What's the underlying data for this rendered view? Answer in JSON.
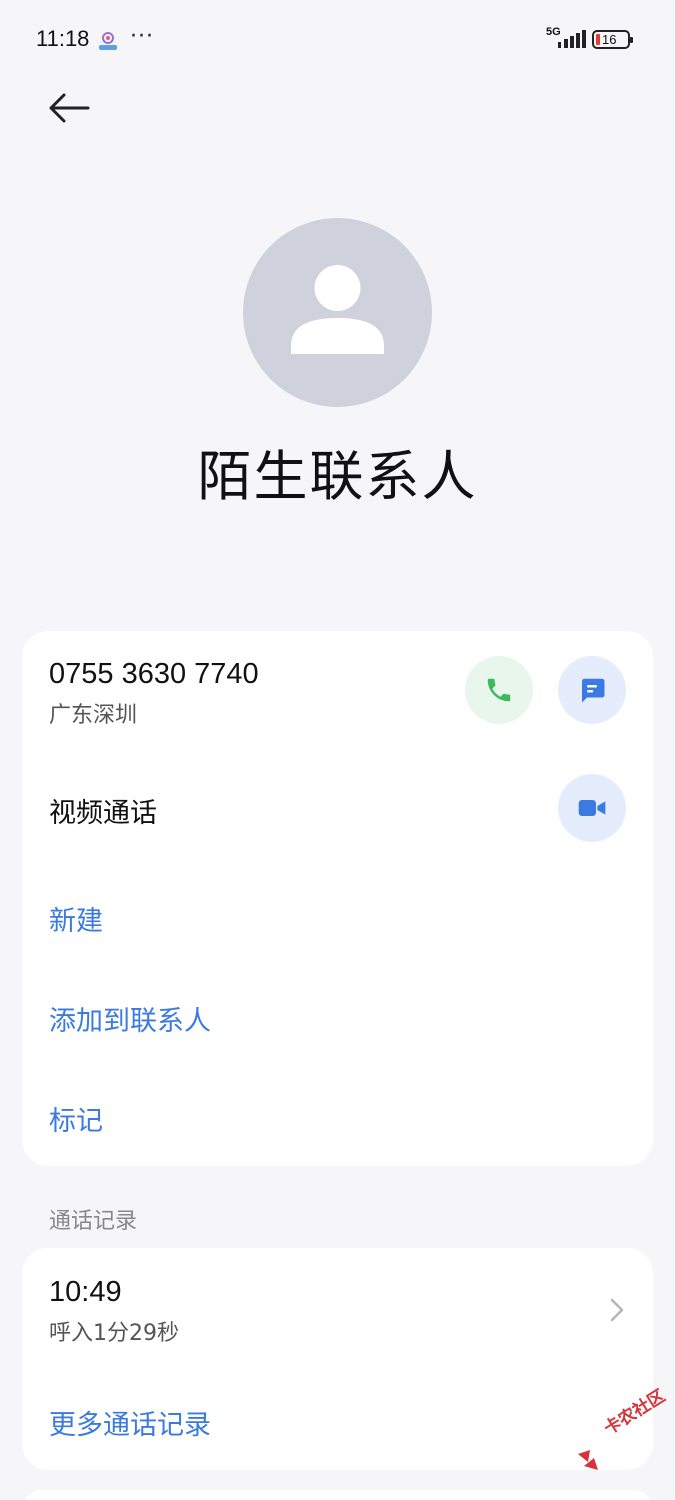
{
  "status_bar": {
    "time": "11:18",
    "more": "···",
    "network": "5G",
    "battery_level": "16",
    "battery_color": "#e03b3b"
  },
  "header": {
    "back_icon": "arrow-left-icon"
  },
  "contact": {
    "avatar_icon": "person-icon",
    "name": "陌生联系人"
  },
  "number_card": {
    "phone_number": "0755 3630 7740",
    "location": "广东深圳",
    "call_icon": "phone-icon",
    "message_icon": "message-icon",
    "video_call_label": "视频通话",
    "video_icon": "video-camera-icon",
    "actions": {
      "new": "新建",
      "add_to_contacts": "添加到联系人",
      "mark": "标记"
    }
  },
  "call_log": {
    "section_title": "通话记录",
    "entries": [
      {
        "time": "10:49",
        "description": "呼入1分29秒"
      }
    ],
    "more_link": "更多通话记录"
  },
  "watermark": {
    "text": "卡农社区"
  },
  "colors": {
    "accent": "#3b7ae0",
    "call_green": "#3cba5e",
    "avatar_bg": "#cfd2dc",
    "page_bg": "#f6f6f8"
  }
}
